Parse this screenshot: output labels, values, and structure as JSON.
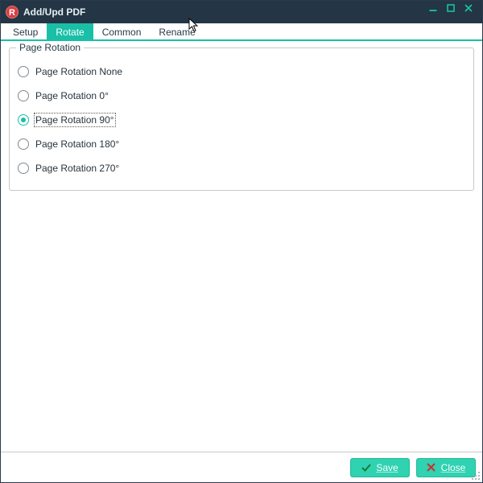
{
  "window": {
    "title": "Add/Upd PDF"
  },
  "tabs": [
    {
      "label": "Setup",
      "active": false
    },
    {
      "label": "Rotate",
      "active": true
    },
    {
      "label": "Common",
      "active": false
    },
    {
      "label": "Rename",
      "active": false
    }
  ],
  "group": {
    "legend": "Page Rotation"
  },
  "rotation_options": [
    {
      "label": "Page Rotation None",
      "selected": false
    },
    {
      "label": "Page Rotation 0°",
      "selected": false
    },
    {
      "label": "Page Rotation 90°",
      "selected": true
    },
    {
      "label": "Page Rotation 180°",
      "selected": false
    },
    {
      "label": "Page Rotation 270°",
      "selected": false
    }
  ],
  "footer": {
    "save_label": "Save",
    "close_label": "Close"
  },
  "colors": {
    "accent": "#19bfa7",
    "titlebar": "#243645",
    "button_bg": "#2fd2b1",
    "close_x": "#cf2f2f"
  }
}
